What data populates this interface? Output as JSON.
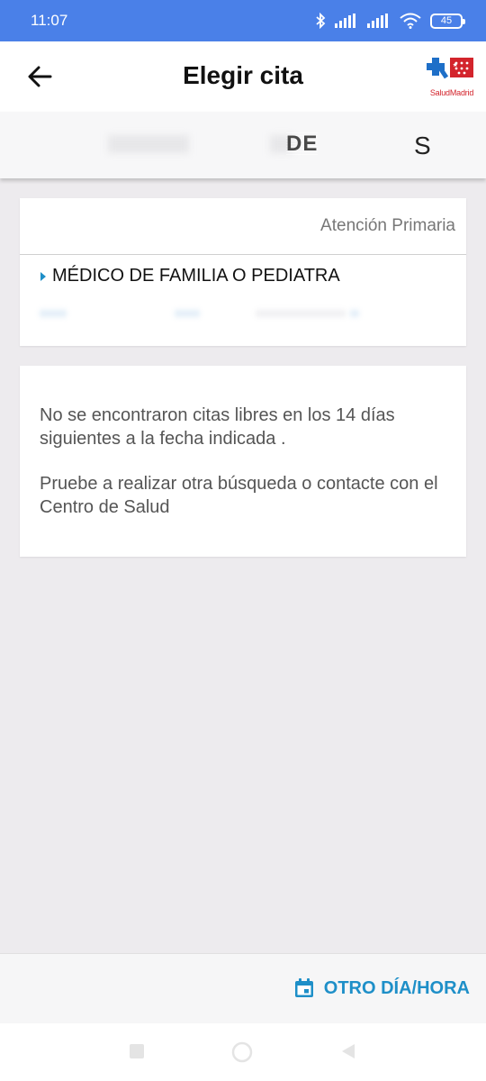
{
  "status_bar": {
    "time": "11:07",
    "battery": "45"
  },
  "header": {
    "title": "Elegir cita",
    "logo_text": "SaludMadrid"
  },
  "date_strip": {
    "partial_text": "DE",
    "letter": "S"
  },
  "appointment_card": {
    "care_type": "Atención Primaria",
    "specialty": "MÉDICO DE FAMILIA O PEDIATRA"
  },
  "message_card": {
    "line_1": "No se encontraron citas libres en los 14 días siguientes a la fecha indicada .",
    "line_2": "Pruebe a realizar otra búsqueda o contacte con el Centro de Salud"
  },
  "bottom_bar": {
    "other_date_label": "OTRO DÍA/HORA"
  },
  "colors": {
    "status_bar": "#4a80e8",
    "accent": "#1e8fc8",
    "logo_red": "#d3242c",
    "background": "#edebee"
  },
  "icons": {
    "back": "arrow-left-icon",
    "calendar": "calendar-icon",
    "specialty_marker": "caret-right-icon",
    "nav_recent": "square-icon",
    "nav_home": "circle-icon",
    "nav_back": "triangle-icon"
  }
}
